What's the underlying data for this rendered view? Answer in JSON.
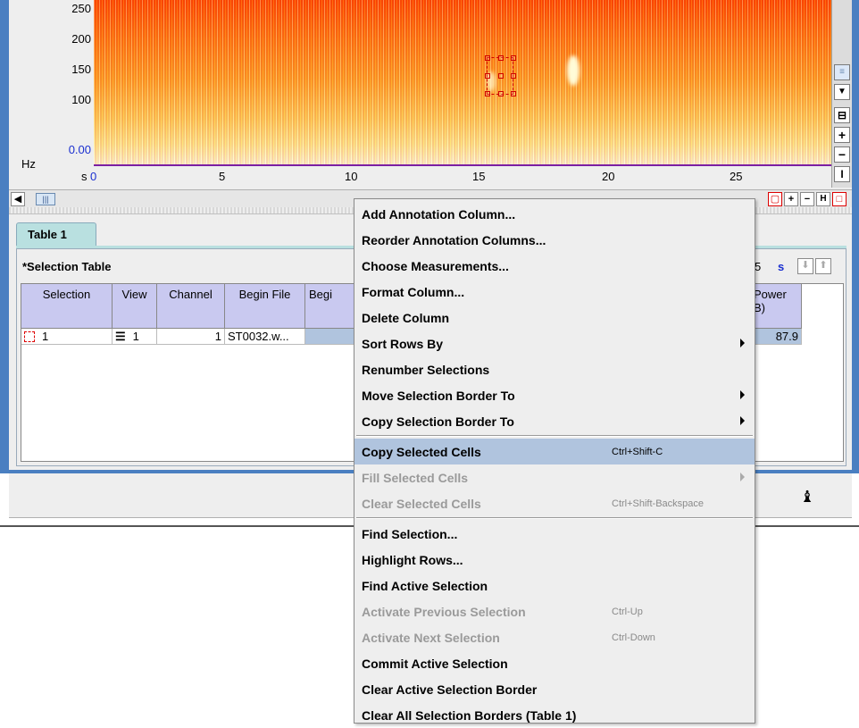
{
  "spectrogram": {
    "y_unit": "Hz",
    "y_ticks": [
      "250",
      "200",
      "150",
      "100",
      "0.00"
    ],
    "x_unit": "s",
    "x_ticks": [
      "0",
      "5",
      "10",
      "15",
      "20",
      "25"
    ]
  },
  "right_tools": [
    "+",
    "−",
    "I",
    "+",
    "−"
  ],
  "bottom_tools": [
    "+",
    "−",
    "H"
  ],
  "tab": {
    "label": "Table 1"
  },
  "table": {
    "title": "*Selection Table",
    "time_unit": "s",
    "partial_value": "5",
    "columns": [
      "Selection",
      "View",
      "Channel",
      "Begin File",
      "Begi"
    ],
    "power_header": [
      "Power",
      "B)"
    ],
    "row": {
      "selection": "1",
      "view": "1",
      "channel": "1",
      "begin_file": "ST0032.w...",
      "power": "87.9"
    }
  },
  "context_menu": [
    {
      "label": "Add Annotation Column...",
      "enabled": true
    },
    {
      "label": "Reorder Annotation Columns...",
      "enabled": true
    },
    {
      "label": "Choose Measurements...",
      "enabled": true
    },
    {
      "label": "Format Column...",
      "enabled": true
    },
    {
      "label": "Delete Column",
      "enabled": true
    },
    {
      "label": "Sort Rows By",
      "enabled": true,
      "submenu": true
    },
    {
      "label": "Renumber Selections",
      "enabled": true
    },
    {
      "label": "Move Selection Border To",
      "enabled": true,
      "submenu": true
    },
    {
      "label": "Copy Selection Border To",
      "enabled": true,
      "submenu": true
    },
    {
      "separator": true
    },
    {
      "label": "Copy Selected Cells",
      "enabled": true,
      "shortcut": "Ctrl+Shift-C",
      "highlighted": true
    },
    {
      "label": "Fill Selected Cells",
      "enabled": false,
      "submenu": true
    },
    {
      "label": "Clear Selected Cells",
      "enabled": false,
      "shortcut": "Ctrl+Shift-Backspace"
    },
    {
      "separator": true
    },
    {
      "label": "Find Selection...",
      "enabled": true
    },
    {
      "label": "Highlight Rows...",
      "enabled": true
    },
    {
      "label": "Find Active Selection",
      "enabled": true
    },
    {
      "label": "Activate Previous Selection",
      "enabled": false,
      "shortcut": "Ctrl-Up"
    },
    {
      "label": "Activate Next Selection",
      "enabled": false,
      "shortcut": "Ctrl-Down"
    },
    {
      "label": "Commit Active Selection",
      "enabled": true
    },
    {
      "label": "Clear Active Selection Border",
      "enabled": true
    },
    {
      "label": "Clear All Selection Borders (Table 1)",
      "enabled": true
    }
  ]
}
